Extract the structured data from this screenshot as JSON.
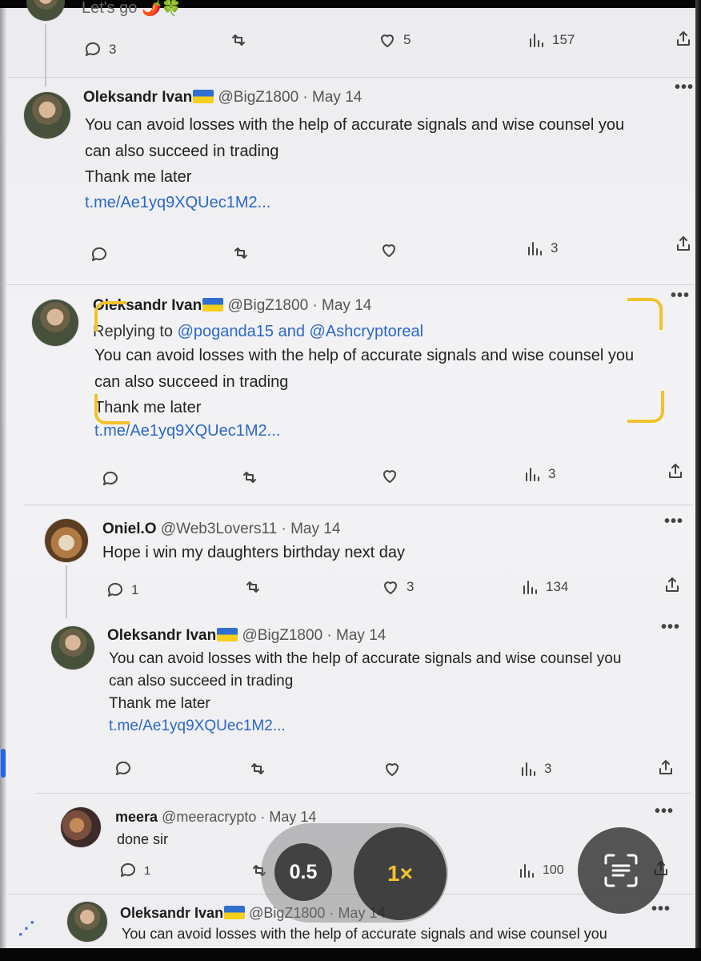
{
  "top_partial": {
    "text": "Let's go 🌶️🍀",
    "replies": "3",
    "likes": "5",
    "views": "157"
  },
  "tweets": [
    {
      "name": "Oleksandr Ivan",
      "handle": "@BigZ1800",
      "date": "May 14",
      "replying_prefix": "",
      "replying_mentions": "",
      "line1": "You can avoid losses with the help of accurate signals and wise counsel you",
      "line2": "can also succeed in trading",
      "line3": "Thank me later",
      "link": "t.me/Ae1yq9XQUec1M2...",
      "replies": "",
      "likes": "",
      "views": "3"
    },
    {
      "name": "Oleksandr Ivan",
      "handle": "@BigZ1800",
      "date": "May 14",
      "replying_prefix": "Replying to ",
      "replying_mentions": "@poganda15 and @Ashcryptoreal",
      "line1": "You can avoid losses with the help of accurate signals and wise counsel you",
      "line2": "can also succeed in trading",
      "line3": "Thank me later",
      "link": "t.me/Ae1yq9XQUec1M2...",
      "replies": "",
      "likes": "",
      "views": "3"
    },
    {
      "name": "Oniel.O",
      "handle": "@Web3Lovers11",
      "date": "May 14",
      "text": "Hope i win my daughters birthday next day",
      "replies": "1",
      "likes": "3",
      "views": "134"
    },
    {
      "name": "Oleksandr Ivan",
      "handle": "@BigZ1800",
      "date": "May 14",
      "line1": "You can avoid losses with the help of accurate signals and wise counsel you",
      "line2": "can also succeed in trading",
      "line3": "Thank me later",
      "link": "t.me/Ae1yq9XQUec1M2...",
      "replies": "",
      "likes": "",
      "views": "3"
    },
    {
      "name": "meera",
      "handle": "@meeracrypto",
      "date": "May 14",
      "text": "done sir",
      "replies": "1",
      "likes": "",
      "views": "100"
    },
    {
      "name": "Oleksandr Ivan",
      "handle": "@BigZ1800",
      "date": "May 14",
      "line1": "You can avoid losses with the help of accurate signals and wise counsel you"
    }
  ],
  "camera": {
    "zoom_05": "0.5",
    "zoom_1": "1×"
  },
  "icons": [
    "reply-icon",
    "retweet-icon",
    "like-icon",
    "views-icon",
    "share-icon",
    "more-icon",
    "scan-text-icon"
  ],
  "colors": {
    "link": "#2b67c6",
    "focus": "#f3c12a",
    "flag_blue": "#2f6fd0",
    "flag_yellow": "#f6cf1e"
  },
  "ui": {
    "dot": "·",
    "more": "•••"
  }
}
